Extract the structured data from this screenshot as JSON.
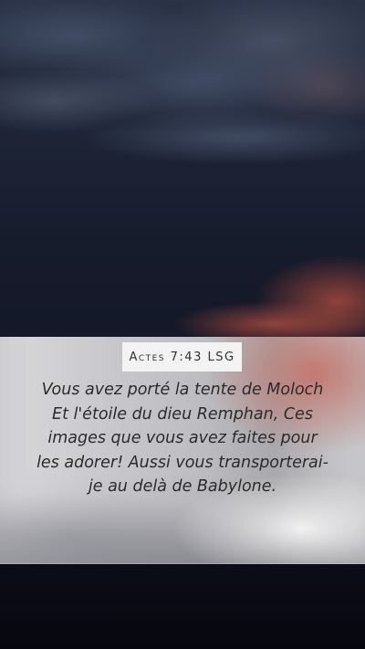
{
  "reference": "Actes 7:43 LSG",
  "verse": "Vous avez porté la tente de Moloch Et l'étoile du dieu Remphan, Ces images que vous avez faites pour les adorer! Aussi vous transporterai-je au delà de Babylone.",
  "colors": {
    "sky_top": "#2a3347",
    "sky_bottom": "#07070f",
    "cloud_glow": "#c0574a",
    "band_light": "#d9d9dc",
    "text": "#2b2b2b"
  }
}
